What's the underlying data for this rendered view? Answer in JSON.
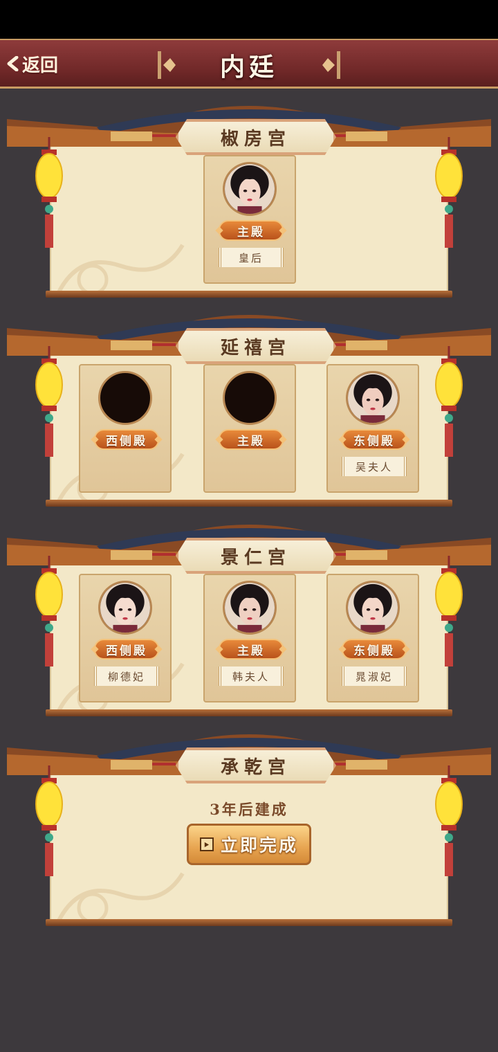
{
  "header": {
    "back_label": "返回",
    "title": "内廷"
  },
  "palaces": [
    {
      "name": "椒房宫",
      "slots": [
        {
          "hall": "主殿",
          "occupant": "皇后",
          "position": "center",
          "filled": true
        }
      ]
    },
    {
      "name": "延禧宫",
      "slots": [
        {
          "hall": "西侧殿",
          "occupant": "",
          "position": "left",
          "filled": false
        },
        {
          "hall": "主殿",
          "occupant": "",
          "position": "center",
          "filled": false
        },
        {
          "hall": "东侧殿",
          "occupant": "吴夫人",
          "position": "right",
          "filled": true
        }
      ]
    },
    {
      "name": "景仁宫",
      "slots": [
        {
          "hall": "西侧殿",
          "occupant": "柳德妃",
          "position": "left",
          "filled": true
        },
        {
          "hall": "主殿",
          "occupant": "韩夫人",
          "position": "center",
          "filled": true
        },
        {
          "hall": "东侧殿",
          "occupant": "晁淑妃",
          "position": "right",
          "filled": true
        }
      ]
    },
    {
      "name": "承乾宫",
      "build_status": "3年后建成",
      "finish_button": "立即完成"
    }
  ],
  "colors": {
    "header_bg": "#7a2d2d",
    "panel_bg": "#f3e8c8",
    "badge": "#d86d2a",
    "page_bg": "#3d393d"
  }
}
